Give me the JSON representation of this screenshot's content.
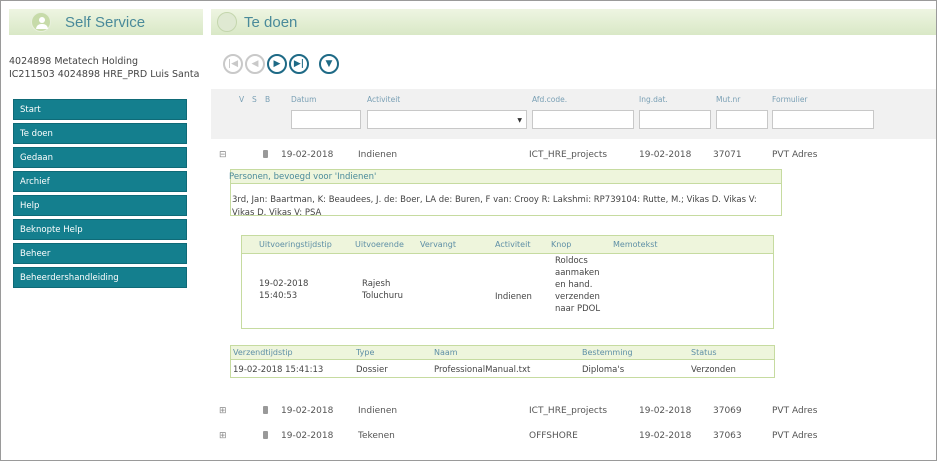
{
  "app": {
    "title": "Self Service"
  },
  "page": {
    "title": "Te doen"
  },
  "user": {
    "line1": "4024898 Metatech Holding",
    "line2": "IC211503 4024898 HRE_PRD Luis Santa"
  },
  "nav": {
    "items": [
      {
        "label": "Start"
      },
      {
        "label": "Te doen"
      },
      {
        "label": "Gedaan"
      },
      {
        "label": "Archief"
      },
      {
        "label": "Help"
      },
      {
        "label": "Beknopte Help"
      },
      {
        "label": "Beheer"
      },
      {
        "label": "Beheerdershandleiding"
      }
    ]
  },
  "pager": {
    "first_icon": "first-page-icon",
    "prev_icon": "previous-page-icon",
    "next_icon": "next-page-icon",
    "last_icon": "last-page-icon",
    "filter_icon": "filter-icon"
  },
  "grid": {
    "headers": {
      "v": "V",
      "s": "S",
      "b": "B",
      "datum": "Datum",
      "activiteit": "Activiteit",
      "afdcode": "Afd.code.",
      "ingdat": "Ing.dat.",
      "mutnr": "Mut.nr",
      "formulier": "Formulier"
    },
    "rows": [
      {
        "expander": "⊟",
        "datum": "19-02-2018",
        "activiteit": "Indienen",
        "afdcode": "ICT_HRE_projects",
        "ingdat": "19-02-2018",
        "mutnr": "37071",
        "formulier": "PVT Adres"
      },
      {
        "expander": "⊞",
        "datum": "19-02-2018",
        "activiteit": "Indienen",
        "afdcode": "ICT_HRE_projects",
        "ingdat": "19-02-2018",
        "mutnr": "37069",
        "formulier": "PVT Adres"
      },
      {
        "expander": "⊞",
        "datum": "19-02-2018",
        "activiteit": "Tekenen",
        "afdcode": "OFFSHORE",
        "ingdat": "19-02-2018",
        "mutnr": "37063",
        "formulier": "PVT Adres"
      }
    ]
  },
  "detail": {
    "permissions_title": "Personen, bevoegd voor 'Indienen'",
    "permissions_text": "3rd, Jan: Baartman, K: Beaudees, J. de: Boer, LA de: Buren, F van: Crooy R: Lakshmi: RP739104: Rutte, M.; Vikas D. Vikas V: Vikas D. Vikas V: PSA",
    "history": {
      "headers": [
        "Uitvoeringstijdstip",
        "Uitvoerende",
        "Vervangt",
        "Activiteit",
        "Knop",
        "Memotekst"
      ],
      "row": {
        "tijdstip_date": "19-02-2018",
        "tijdstip_time": "15:40:53",
        "uitvoerende_1": "Rajesh",
        "uitvoerende_2": "Toluchuru",
        "vervangt": "",
        "activiteit": "Indienen",
        "knop": [
          "Roldocs",
          "aanmaken",
          "en hand.",
          "verzenden",
          "naar PDOL"
        ],
        "memotekst": ""
      }
    },
    "dispatch": {
      "headers": [
        "Verzendtijdstip",
        "Type",
        "Naam",
        "Bestemming",
        "Status"
      ],
      "row": [
        "19-02-2018 15:41:13",
        "Dossier",
        "ProfessionalManual.txt",
        "Diploma's",
        "Verzonden"
      ]
    }
  }
}
